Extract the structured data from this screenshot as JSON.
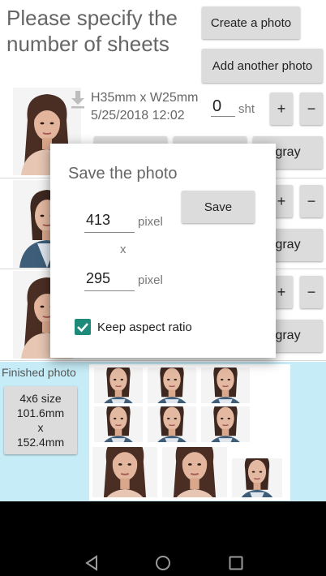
{
  "header": {
    "title": "Please specify the number of sheets",
    "create_photo_label": "Create a photo",
    "add_photo_label": "Add another photo"
  },
  "rows": [
    {
      "size": "H35mm x W25mm",
      "datetime": "5/25/2018 12:02",
      "quantity": "0",
      "unit": "sht",
      "plus": "+",
      "minus": "−",
      "gray_label": "gray"
    },
    {
      "plus": "+",
      "minus": "−",
      "gray_label": "gray"
    },
    {
      "plus": "+",
      "minus": "−",
      "gray_label": "gray"
    }
  ],
  "dialog": {
    "title": "Save the photo",
    "save_label": "Save",
    "width_value": "413",
    "height_value": "295",
    "unit": "pixel",
    "separator": "x",
    "keep_aspect_label": "Keep aspect ratio",
    "keep_aspect_checked": true
  },
  "finished": {
    "label": "Finished photo",
    "size_button_label": "4x6 size\n101.6mm\nx\n152.4mm"
  },
  "colors": {
    "accent": "#1e8b7a",
    "bottom_bg": "#c6ecf7",
    "button_bg": "#dcdcdc"
  },
  "navbar": {
    "icons": [
      "back-icon",
      "home-icon",
      "recents-icon"
    ]
  }
}
